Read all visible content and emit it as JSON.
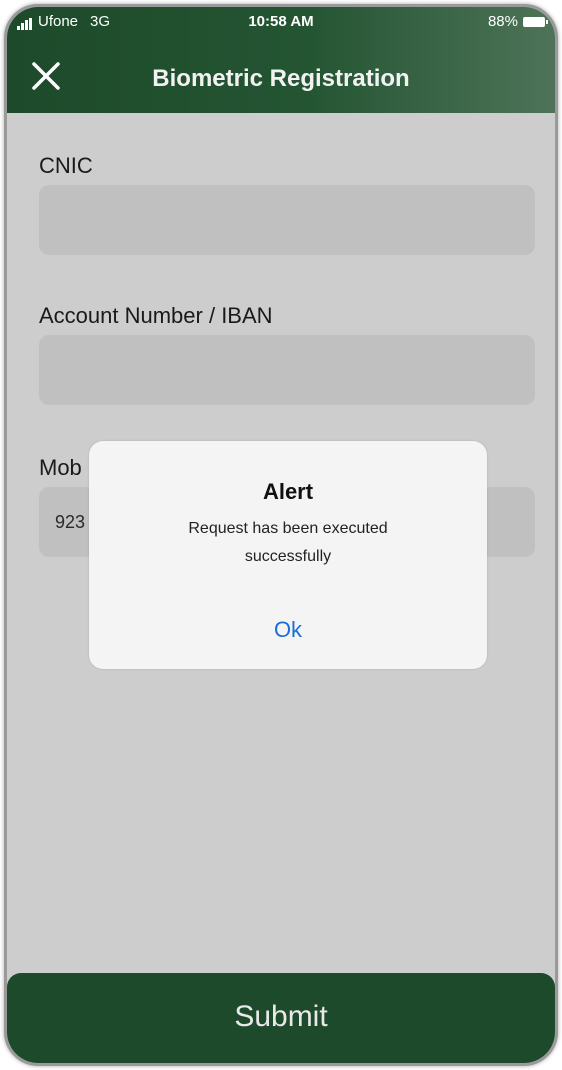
{
  "status_bar": {
    "carrier": "Ufone",
    "network": "3G",
    "time": "10:58 AM",
    "battery": "88%"
  },
  "header": {
    "close_icon": "close-icon",
    "title": "Biometric Registration"
  },
  "form": {
    "cnic_label": "CNIC",
    "cnic_value": "",
    "account_label": "Account Number / IBAN",
    "account_value": "",
    "mobile_label_visible": "Mob",
    "mobile_value_visible": "923"
  },
  "alert": {
    "title": "Alert",
    "message": "Request has been executed successfully",
    "ok_label": "Ok"
  },
  "submit_label": "Submit",
  "colors": {
    "header": "#245533",
    "submit": "#1d4a2a",
    "ok_link": "#1a6fd6",
    "overlay": "#cdcdcd"
  }
}
